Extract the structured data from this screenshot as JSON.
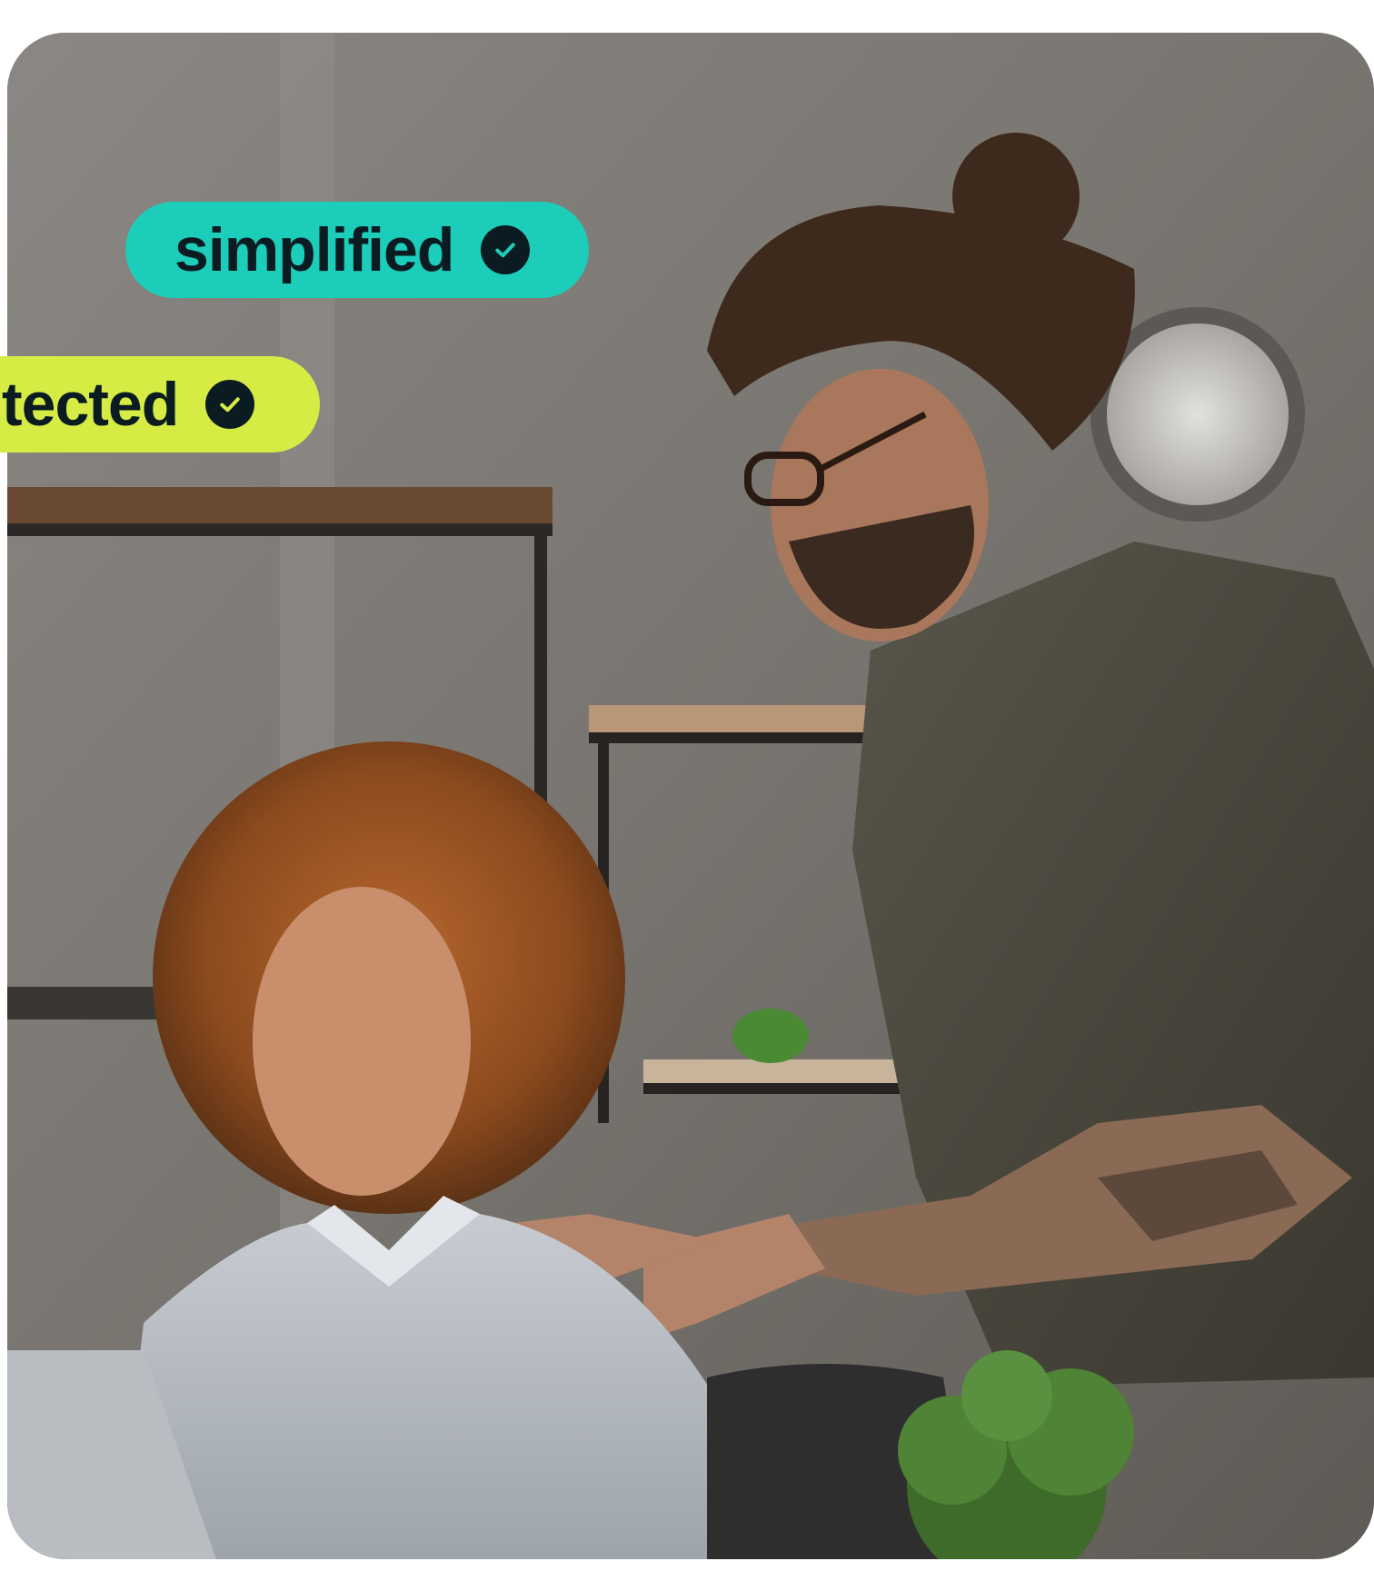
{
  "badges": {
    "simplified": {
      "label": "simplified",
      "icon": "check-circle-icon",
      "color": "#1ccdb9"
    },
    "protected": {
      "label": "protected",
      "visible_label": "tected",
      "icon": "check-circle-icon",
      "color": "#d6ec45"
    }
  },
  "photo": {
    "subject": "photo-two-coworkers-at-laptop"
  }
}
